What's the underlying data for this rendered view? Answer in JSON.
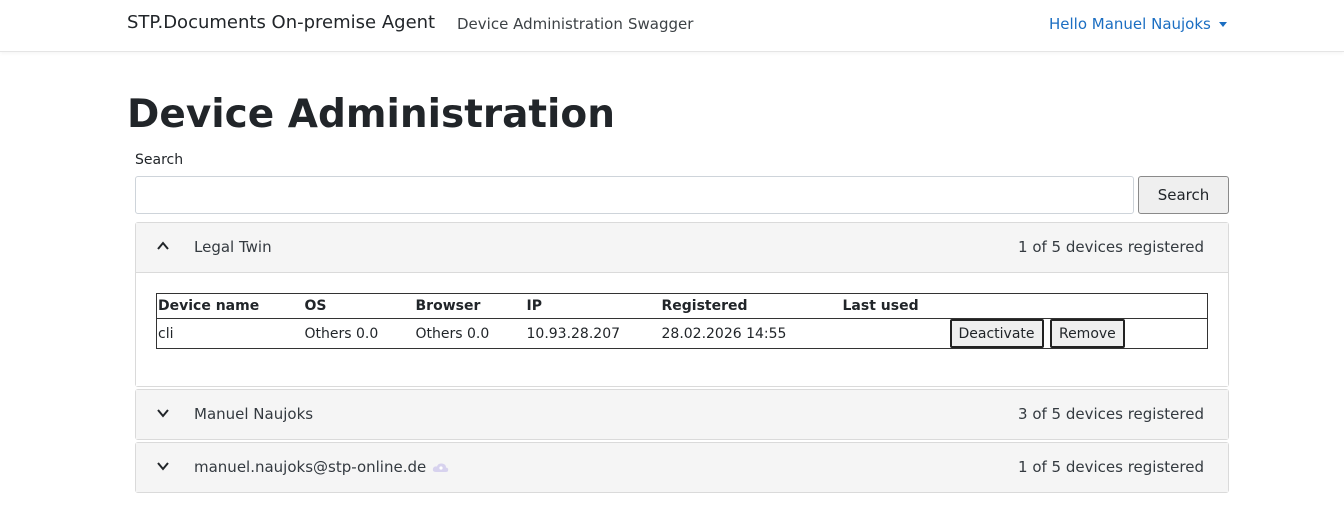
{
  "navbar": {
    "brand": "STP.Documents On-premise Agent",
    "links": [
      "Device Administration",
      "Swagger"
    ],
    "user_menu": "Hello Manuel Naujoks"
  },
  "page": {
    "title": "Device Administration",
    "search_label": "Search",
    "search_value": "",
    "search_button": "Search"
  },
  "groups": [
    {
      "name": "Legal Twin",
      "count": "1 of 5 devices registered",
      "expanded": true,
      "table": {
        "headers": [
          "Device name",
          "OS",
          "Browser",
          "IP",
          "Registered",
          "Last used"
        ],
        "rows": [
          {
            "device_name": "cli",
            "os": "Others 0.0",
            "browser": "Others 0.0",
            "ip": "10.93.28.207",
            "registered": "28.02.2026 14:55",
            "last_used": "",
            "deactivate_label": "Deactivate",
            "remove_label": "Remove"
          }
        ]
      }
    },
    {
      "name": "Manuel Naujoks",
      "count": "3 of 5 devices registered",
      "expanded": false
    },
    {
      "name": "manuel.naujoks@stp-online.de",
      "count": "1 of 5 devices registered",
      "expanded": false,
      "badge_icon": "verified-cloud-icon"
    }
  ],
  "colors": {
    "link_blue": "#1b6ec2",
    "header_bg": "#f5f5f5",
    "border": "#dadada"
  }
}
